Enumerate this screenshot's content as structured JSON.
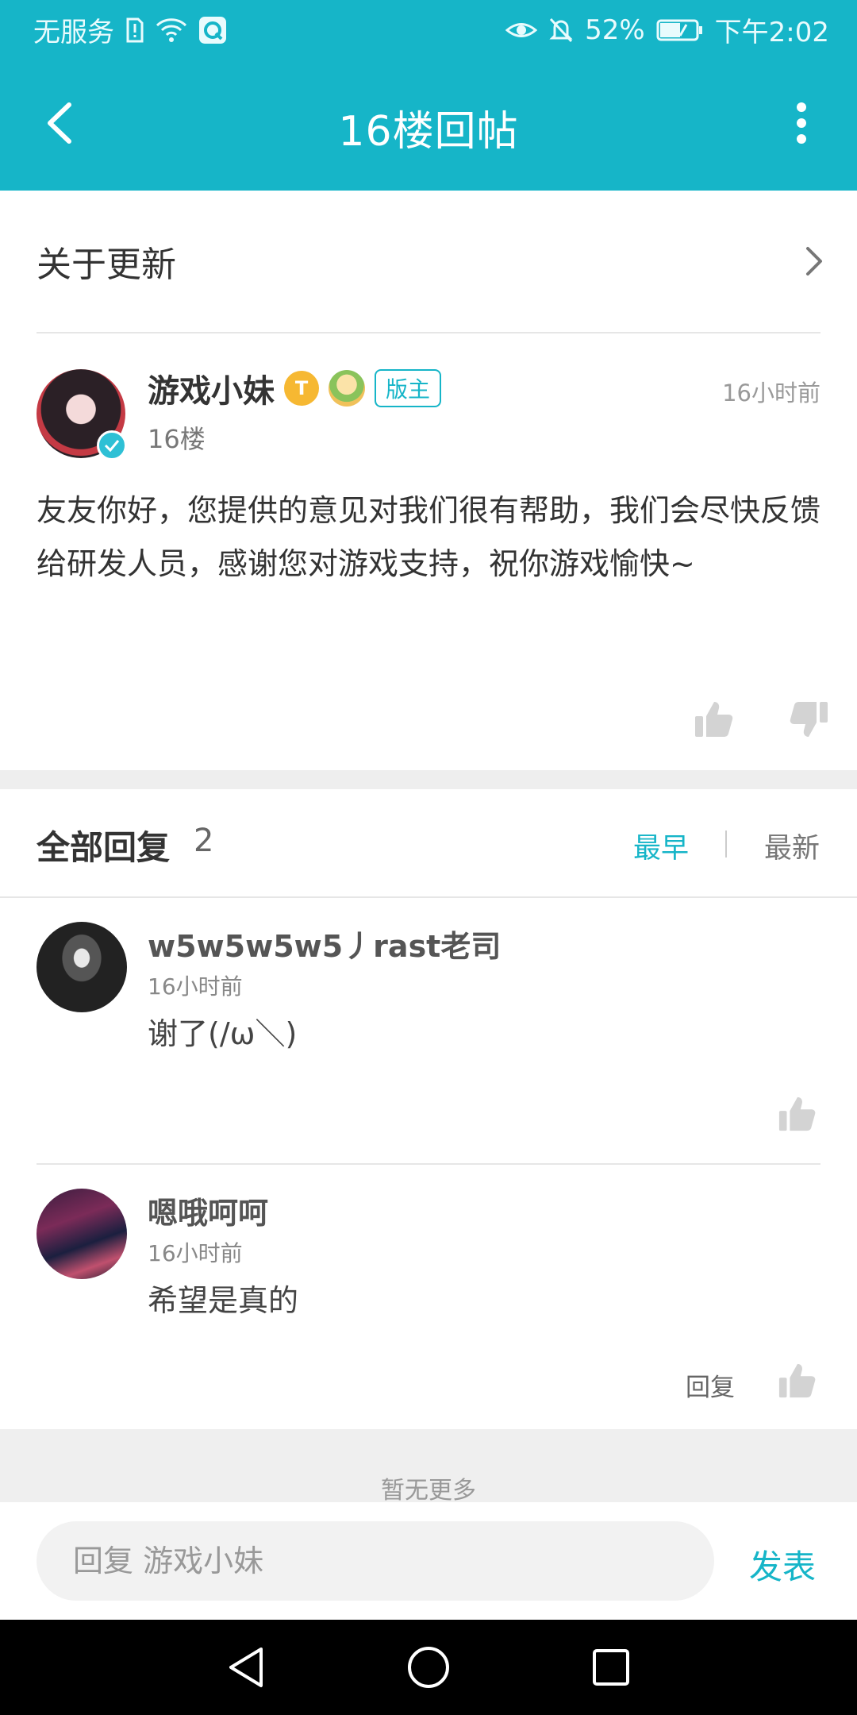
{
  "status_bar": {
    "carrier": "无服务",
    "battery": "52%",
    "time": "下午2:02"
  },
  "top_bar": {
    "title": "16楼回帖"
  },
  "thread_link": {
    "label": "关于更新"
  },
  "post": {
    "username": "游戏小妹",
    "level_badge": "T",
    "moderator_badge": "版主",
    "time": "16小时前",
    "floor": "16楼",
    "content": "友友你好，您提供的意见对我们很有帮助，我们会尽快反馈给研发人员，感谢您对游戏支持，祝你游戏愉快~"
  },
  "replies_header": {
    "title": "全部回复",
    "count": "2",
    "sort_earliest": "最早",
    "sort_latest": "最新"
  },
  "replies": [
    {
      "username": "w5w5w5w5丿rast老司",
      "time": "16小时前",
      "text": "谢了(/ω＼)"
    },
    {
      "username": "嗯哦呵呵",
      "time": "16小时前",
      "text": "希望是真的",
      "reply_label": "回复"
    }
  ],
  "footer": {
    "no_more": "暂无更多"
  },
  "composer": {
    "placeholder": "回复 游戏小妹",
    "send_label": "发表"
  },
  "colors": {
    "accent": "#16b5c8",
    "text": "#333333",
    "muted": "#999999"
  },
  "icons": {
    "back": "chevron-left-icon",
    "more": "more-vertical-icon",
    "chevron": "chevron-right-icon",
    "like": "thumbs-up-icon",
    "dislike": "thumbs-down-icon"
  }
}
